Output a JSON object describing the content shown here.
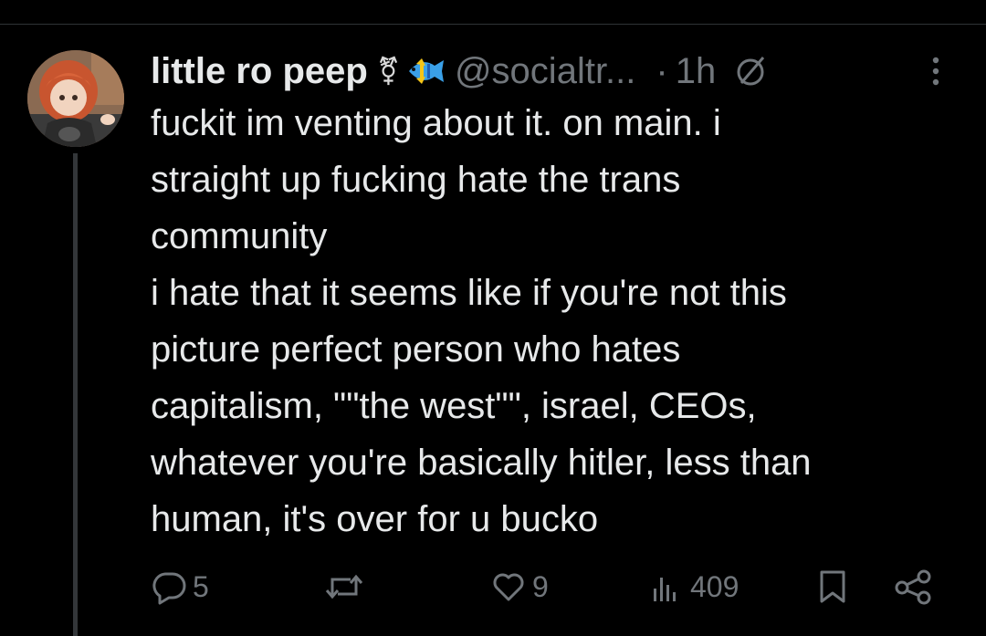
{
  "tweet": {
    "display_name": "little ro peep",
    "gender_emoji": "⚧",
    "fish_emoji_name": "tropical-fish-icon",
    "handle": "@socialtr...",
    "separator": "·",
    "time": "1h",
    "status_icon_name": "circle-slash-icon",
    "more_icon_name": "more-options-icon",
    "text_lines": [
      "fuckit im venting about it. on main. i",
      "straight up fucking hate the trans",
      "community",
      "i hate that it seems like if you're not this",
      "picture perfect person who hates",
      "capitalism, \"\"the west\"\", israel, CEOs,",
      "whatever you're basically hitler, less than",
      "human, it's over for u bucko"
    ]
  },
  "actions": {
    "replies": "5",
    "reposts": "",
    "likes": "9",
    "views": "409",
    "reply_icon": "reply-icon",
    "repost_icon": "repost-icon",
    "like_icon": "heart-icon",
    "views_icon": "views-chart-icon",
    "bookmark_icon": "bookmark-icon",
    "share_icon": "share-icon"
  },
  "colors": {
    "background": "#000000",
    "text_primary": "#e7e9ea",
    "text_secondary": "#71767b",
    "divider": "#2f3336"
  }
}
